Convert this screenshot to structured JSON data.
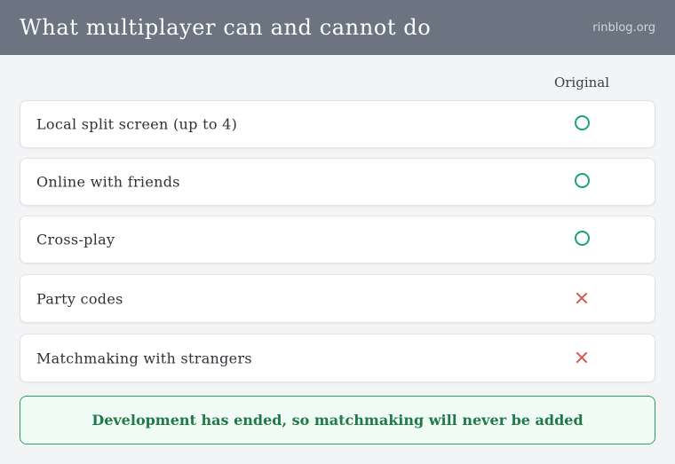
{
  "header": {
    "title": "What multiplayer can and cannot do",
    "site": "rinblog.org"
  },
  "table": {
    "column_header": "Original",
    "rows": [
      {
        "label": "Local split screen (up to 4)",
        "supported": true,
        "mark": "circle-icon"
      },
      {
        "label": "Online with friends",
        "supported": true,
        "mark": "circle-icon"
      },
      {
        "label": "Cross-play",
        "supported": true,
        "mark": "circle-icon"
      },
      {
        "label": "Party codes",
        "supported": false,
        "mark": "cross-icon"
      },
      {
        "label": "Matchmaking with strangers",
        "supported": false,
        "mark": "cross-icon"
      }
    ]
  },
  "notice": {
    "text": "Development has ended, so matchmaking will never be added"
  },
  "colors": {
    "header_bg": "#6b7480",
    "yes": "#1aa37a",
    "no": "#d9534f",
    "notice_text": "#1f7a48",
    "notice_border": "#2e9e62"
  }
}
